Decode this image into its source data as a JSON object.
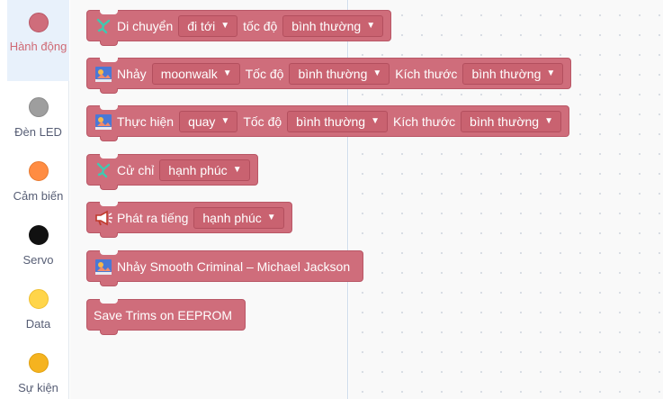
{
  "sidebar": {
    "categories": [
      {
        "label": "Hành động",
        "color": "#cf6d7b",
        "active": true
      },
      {
        "label": "Đèn LED",
        "color": "#9e9e9e"
      },
      {
        "label": "Cảm biến",
        "color": "#ff8c42"
      },
      {
        "label": "Servo",
        "color": "#111111"
      },
      {
        "label": "Data",
        "color": "#ffd54a"
      },
      {
        "label": "Sự kiện",
        "color": "#f5b31f"
      }
    ]
  },
  "blocks": {
    "move": {
      "icon": "dance-figure-icon",
      "label": "Di chuyển",
      "direction": "đi tới",
      "speed_label": "tốc độ",
      "speed": "bình thường"
    },
    "jump": {
      "icon": "dance-stage-icon",
      "label": "Nhảy",
      "dance": "moonwalk",
      "speed_label": "Tốc độ",
      "speed": "bình thường",
      "size_label": "Kích thước",
      "size": "bình thường"
    },
    "perform": {
      "icon": "dance-stage-icon",
      "label": "Thực hiện",
      "action": "quay",
      "speed_label": "Tốc độ",
      "speed": "bình thường",
      "size_label": "Kích thước",
      "size": "bình thường"
    },
    "gesture": {
      "icon": "dance-figure-icon",
      "label": "Cử chỉ",
      "mood": "hạnh phúc"
    },
    "sound": {
      "icon": "megaphone-icon",
      "label": "Phát ra tiếng",
      "mood": "hạnh phúc"
    },
    "smooth": {
      "icon": "dance-stage-icon",
      "label": "Nhảy Smooth Criminal – Michael Jackson"
    },
    "trims": {
      "label": "Save Trims on EEPROM"
    }
  },
  "caret": "▼"
}
